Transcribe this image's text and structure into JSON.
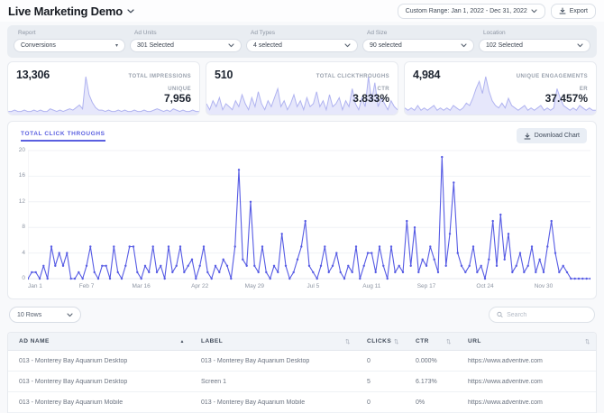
{
  "header": {
    "title": "Live Marketing Demo",
    "date_range": "Custom Range: Jan 1, 2022 - Dec 31, 2022",
    "export_label": "Export"
  },
  "filters": [
    {
      "label": "Report",
      "value": "Conversions"
    },
    {
      "label": "Ad Units",
      "value": "301 Selected"
    },
    {
      "label": "Ad Types",
      "value": "4 selected"
    },
    {
      "label": "Ad Size",
      "value": "90 selected"
    },
    {
      "label": "Location",
      "value": "102 Selected"
    }
  ],
  "stat_cards": [
    {
      "primary_value": "13,306",
      "primary_label": "TOTAL IMPRESSIONS",
      "secondary_label": "UNIQUE",
      "secondary_value": "7,956"
    },
    {
      "primary_value": "510",
      "primary_label": "TOTAL CLICKTHROUGHS",
      "secondary_label": "CTR",
      "secondary_value": "3.833%"
    },
    {
      "primary_value": "4,984",
      "primary_label": "UNIQUE ENGAGEMENTS",
      "secondary_label": "ER",
      "secondary_value": "37.457%"
    }
  ],
  "chart_section": {
    "tab_label": "TOTAL CLICK THROUGHS",
    "download_label": "Download Chart"
  },
  "chart_data": [
    {
      "id": "total-click-throughs",
      "type": "line",
      "title": "TOTAL CLICK THROUGHS",
      "xlabel": "",
      "ylabel": "",
      "ylim": [
        0,
        20
      ],
      "yticks": [
        0,
        4,
        8,
        12,
        16,
        20
      ],
      "grid": true,
      "line_color": "#565be4",
      "x_tick_labels": [
        "Jan 1",
        "Feb 7",
        "Mar 16",
        "Apr 22",
        "May 29",
        "Jul 5",
        "Aug 11",
        "Sep 17",
        "Oct 24",
        "Nov 30"
      ],
      "x_tick_indices": [
        0,
        15,
        29,
        44,
        58,
        73,
        88,
        102,
        117,
        132
      ],
      "values": [
        0,
        1,
        1,
        0,
        2,
        0,
        5,
        2,
        4,
        2,
        4,
        0,
        0,
        1,
        0,
        2,
        5,
        1,
        0,
        2,
        2,
        0,
        5,
        1,
        0,
        2,
        5,
        5,
        1,
        0,
        2,
        1,
        5,
        1,
        2,
        0,
        5,
        1,
        2,
        5,
        1,
        2,
        3,
        0,
        2,
        5,
        1,
        0,
        2,
        1,
        3,
        2,
        0,
        5,
        17,
        3,
        2,
        12,
        2,
        1,
        5,
        1,
        0,
        2,
        1,
        7,
        2,
        0,
        1,
        3,
        5,
        9,
        2,
        1,
        0,
        2,
        5,
        1,
        2,
        4,
        1,
        0,
        2,
        1,
        5,
        0,
        2,
        4,
        4,
        1,
        5,
        2,
        0,
        5,
        1,
        2,
        1,
        9,
        2,
        8,
        1,
        3,
        2,
        5,
        3,
        1,
        19,
        2,
        7,
        15,
        4,
        2,
        1,
        2,
        5,
        1,
        2,
        0,
        3,
        9,
        2,
        10,
        3,
        7,
        1,
        2,
        4,
        1,
        2,
        5,
        1,
        3,
        1,
        5,
        9,
        4,
        1,
        2,
        1,
        0,
        0,
        0,
        0,
        0,
        0
      ]
    },
    {
      "id": "impressions-sparkline",
      "type": "area",
      "title": "Total Impressions trend",
      "values": [
        1,
        1,
        2,
        1,
        1,
        2,
        1,
        1,
        2,
        1,
        2,
        1,
        1,
        3,
        2,
        1,
        2,
        1,
        2,
        3,
        2,
        4,
        6,
        3,
        28,
        14,
        8,
        4,
        2,
        2,
        1,
        2,
        1,
        1,
        2,
        1,
        2,
        1,
        1,
        2,
        1,
        1,
        2,
        1,
        1,
        2,
        3,
        2,
        1,
        2,
        1,
        3,
        2,
        1,
        2,
        1,
        1,
        2,
        1,
        1
      ]
    },
    {
      "id": "clickthroughs-sparkline",
      "type": "area",
      "title": "Total Clickthroughs trend",
      "values": [
        3,
        1,
        4,
        2,
        5,
        1,
        3,
        2,
        1,
        4,
        2,
        6,
        3,
        1,
        5,
        2,
        7,
        3,
        1,
        4,
        2,
        5,
        8,
        2,
        4,
        1,
        3,
        6,
        2,
        4,
        1,
        5,
        2,
        3,
        7,
        2,
        4,
        1,
        6,
        2,
        3,
        5,
        1,
        4,
        2,
        8,
        3,
        1,
        5,
        2,
        12,
        4,
        10,
        2,
        5,
        3,
        1,
        4,
        2,
        1
      ]
    },
    {
      "id": "engagements-sparkline",
      "type": "area",
      "title": "Unique Engagements trend",
      "values": [
        2,
        1,
        2,
        1,
        3,
        1,
        2,
        1,
        2,
        3,
        1,
        2,
        1,
        2,
        1,
        3,
        2,
        1,
        2,
        4,
        3,
        6,
        10,
        13,
        8,
        15,
        9,
        5,
        3,
        2,
        4,
        2,
        6,
        3,
        2,
        1,
        2,
        3,
        1,
        2,
        1,
        2,
        3,
        1,
        2,
        1,
        2,
        10,
        6,
        3,
        2,
        1,
        2,
        1,
        3,
        2,
        1,
        2,
        1,
        1
      ]
    }
  ],
  "table_controls": {
    "rows_selector": "10 Rows",
    "search_placeholder": "Search"
  },
  "table": {
    "columns": [
      {
        "label": "AD NAME",
        "sort": "asc"
      },
      {
        "label": "LABEL",
        "sort": "none"
      },
      {
        "label": "CLICKS",
        "sort": "none"
      },
      {
        "label": "CTR",
        "sort": "none"
      },
      {
        "label": "URL",
        "sort": "none"
      }
    ],
    "rows": [
      [
        "013 - Monterey Bay Aquarium Desktop",
        "013 - Monterey Bay Aquarium Desktop",
        "0",
        "0.000%",
        "https://www.adventive.com"
      ],
      [
        "013 - Monterey Bay Aquarium Desktop",
        "Screen 1",
        "5",
        "6.173%",
        "https://www.adventive.com"
      ],
      [
        "013 - Monterey Bay Aquarium Mobile",
        "013 - Monterey Bay Aquarium Mobile",
        "0",
        "0%",
        "https://www.adventive.com"
      ]
    ]
  },
  "colors": {
    "accent": "#5a5fe0",
    "chart_line": "#565be4",
    "sparkline_stroke": "#b0b3f0",
    "sparkline_fill": "#e6e7fb",
    "filter_bar_bg": "#e9edf2"
  }
}
